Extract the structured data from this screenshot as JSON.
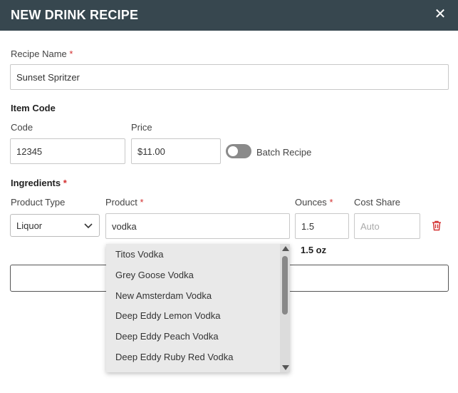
{
  "header": {
    "title": "NEW DRINK RECIPE",
    "close_symbol": "✕",
    "background": "#37474f"
  },
  "recipe_name": {
    "label": "Recipe Name",
    "required_mark": "*",
    "value": "Sunset Spritzer"
  },
  "item_code": {
    "section_title": "Item Code",
    "code_label": "Code",
    "code_value": "12345",
    "price_label": "Price",
    "price_value": "$11.00",
    "batch_label": "Batch Recipe",
    "batch_enabled": false
  },
  "ingredients": {
    "section_title": "Ingredients",
    "required_mark": "*",
    "columns": {
      "product_type": "Product Type",
      "product": "Product",
      "ounces": "Ounces",
      "cost_share": "Cost Share"
    },
    "row": {
      "product_type": "Liquor",
      "product": "vodka",
      "ounces": "1.5",
      "cost_share_placeholder": "Auto",
      "ounces_display": "1.5 oz"
    }
  },
  "dropdown": {
    "options": [
      "Titos Vodka",
      "Grey Goose Vodka",
      "New Amsterdam Vodka",
      "Deep Eddy Lemon Vodka",
      "Deep Eddy Peach Vodka",
      "Deep Eddy Ruby Red Vodka"
    ]
  },
  "colors": {
    "required": "#d32f2f",
    "trash": "#d32f2f",
    "toggle_off": "#8a8a8a"
  }
}
